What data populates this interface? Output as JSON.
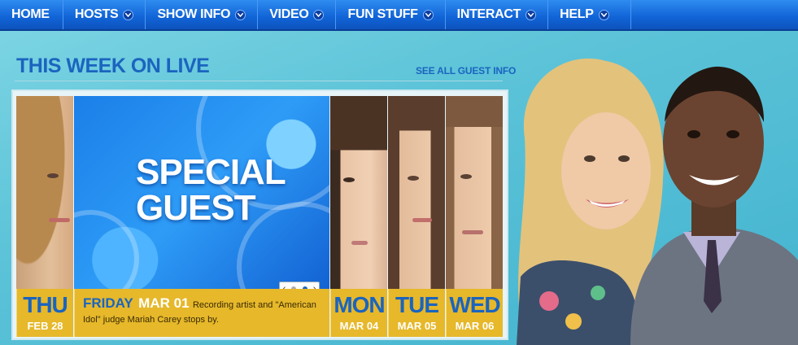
{
  "nav": {
    "items": [
      {
        "label": "HOME",
        "dropdown": false
      },
      {
        "label": "HOSTS",
        "dropdown": true
      },
      {
        "label": "SHOW INFO",
        "dropdown": true
      },
      {
        "label": "VIDEO",
        "dropdown": true
      },
      {
        "label": "FUN STUFF",
        "dropdown": true
      },
      {
        "label": "INTERACT",
        "dropdown": true
      },
      {
        "label": "HELP",
        "dropdown": true
      }
    ]
  },
  "section": {
    "title": "THIS WEEK ON LIVE",
    "see_all": "SEE ALL GUEST INFO"
  },
  "carousel": {
    "thu": {
      "day": "THU",
      "date": "FEB 28"
    },
    "special": {
      "line1": "SPECIAL",
      "line2": "GUEST",
      "day": "FRIDAY",
      "date": "MAR 01",
      "description": "Recording artist and \"American Idol\" judge Mariah Carey stops by."
    },
    "mon": {
      "day": "MON",
      "date": "MAR 04"
    },
    "tue": {
      "day": "TUE",
      "date": "MAR 05"
    },
    "wed": {
      "day": "WED",
      "date": "MAR 06"
    },
    "pager": {
      "prev": "‹",
      "next": "›",
      "pages": 2,
      "current": 2
    }
  },
  "colors": {
    "nav_blue": "#1163d6",
    "title_blue": "#1b64bf",
    "caption_gold": "#e6b82a"
  }
}
